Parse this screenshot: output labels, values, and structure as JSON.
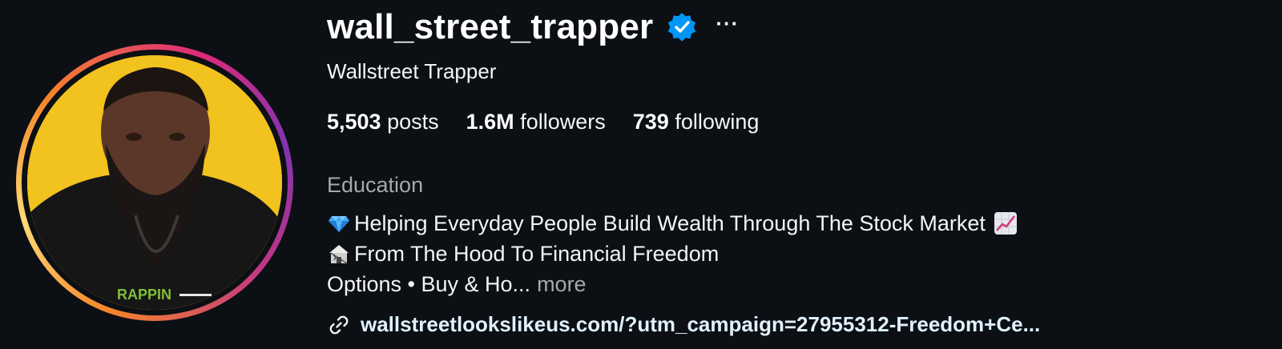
{
  "profile": {
    "username": "wall_street_trapper",
    "verified_icon": "verified-badge-icon",
    "more_options": "···",
    "full_name": "Wallstreet Trapper",
    "avatar_alt": "profile photo",
    "avatar_text": "RAPPIN"
  },
  "stats": {
    "posts_count": "5,503",
    "posts_label": "posts",
    "followers_count": "1.6M",
    "followers_label": "followers",
    "following_count": "739",
    "following_label": "following"
  },
  "bio": {
    "category": "Education",
    "line1": "Helping Everyday People Build Wealth Through The Stock Market",
    "line1_emoji_start": "gem-icon",
    "line1_emoji_end": "chart-increasing-icon",
    "line2": "From The Hood To Financial Freedom",
    "line2_emoji_start": "derelict-house-icon",
    "line3": "Options • Buy & Ho...",
    "more_label": "more"
  },
  "link": {
    "icon": "link-icon",
    "text": "wallstreetlookslikeus.com/?utm_campaign=27955312-Freedom+Ce..."
  },
  "colors": {
    "background": "#0c0f14",
    "verified_blue": "#0095f6",
    "muted_text": "#a8a8a8",
    "avatar_bg": "#f2c21e"
  }
}
